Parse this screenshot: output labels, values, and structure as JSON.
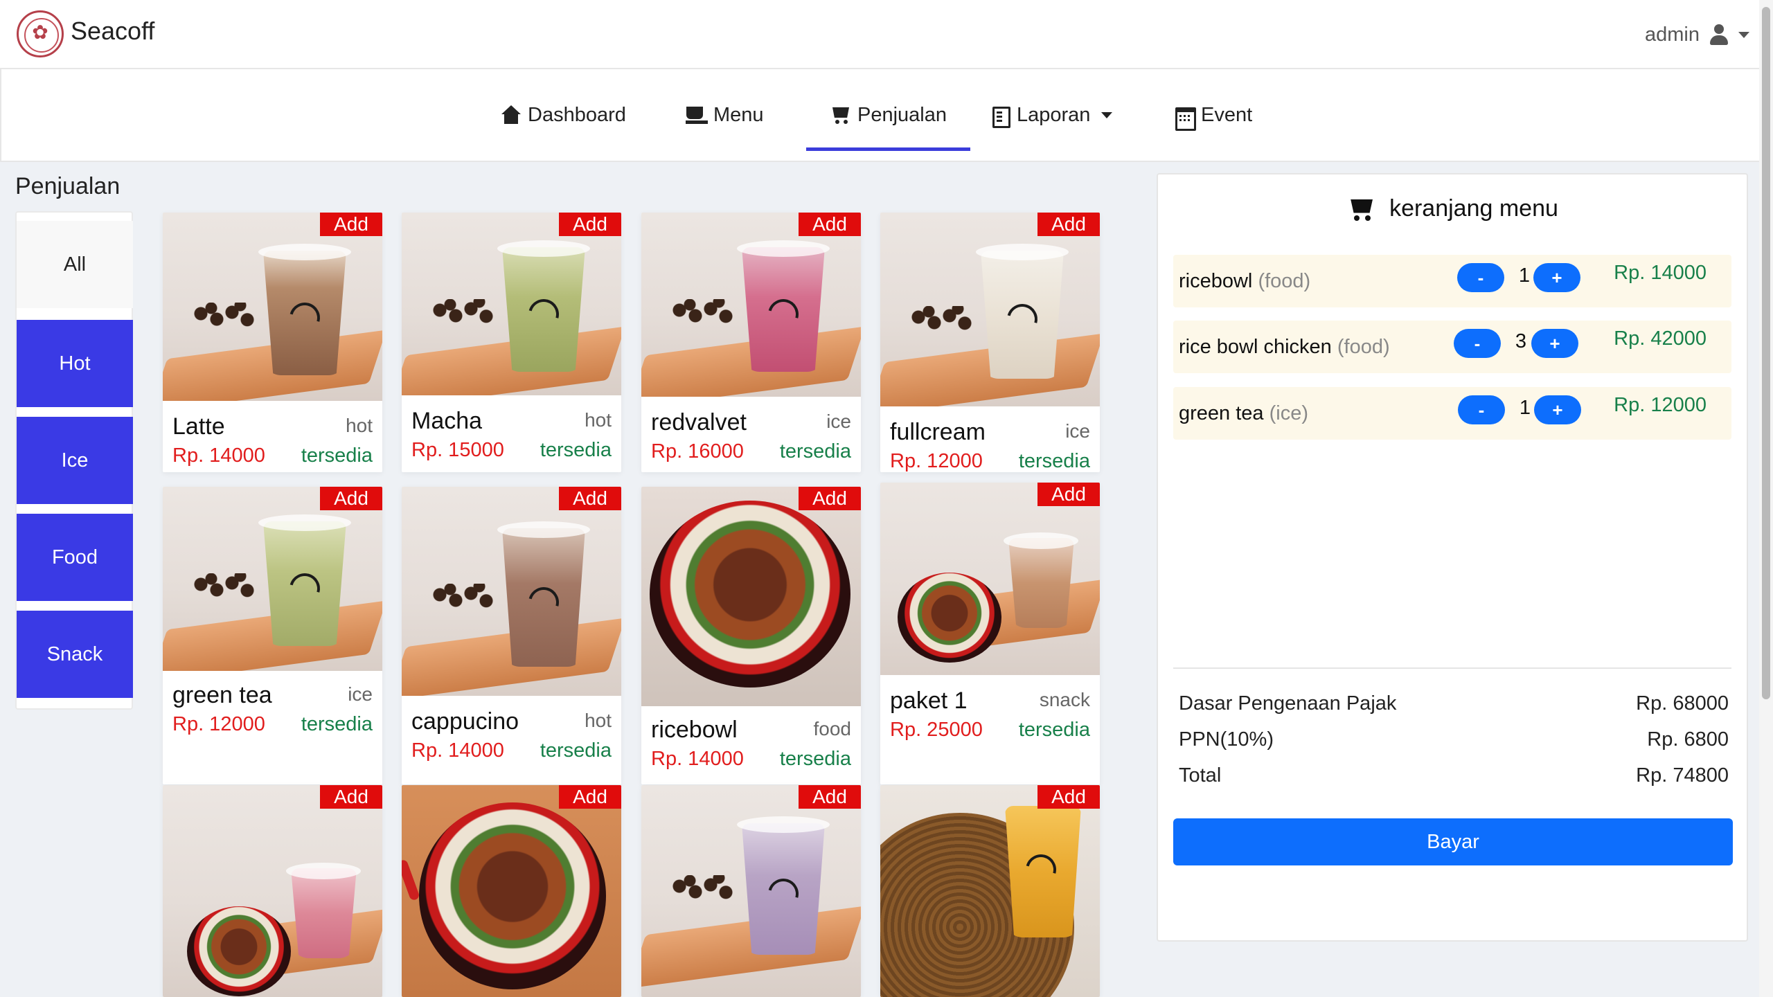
{
  "app": {
    "brand": "Seacoff",
    "user": "admin"
  },
  "nav": {
    "dashboard": "Dashboard",
    "menu": "Menu",
    "penjualan": "Penjualan",
    "laporan": "Laporan",
    "event": "Event",
    "active": "Penjualan"
  },
  "page": {
    "title": "Penjualan"
  },
  "categories": [
    "All",
    "Hot",
    "Ice",
    "Food",
    "Snack"
  ],
  "add_label": "Add",
  "products": [
    {
      "name": "Latte",
      "type": "hot",
      "price": "Rp. 14000",
      "stock": "tersedia"
    },
    {
      "name": "Macha",
      "type": "hot",
      "price": "Rp. 15000",
      "stock": "tersedia"
    },
    {
      "name": "redvalvet",
      "type": "ice",
      "price": "Rp. 16000",
      "stock": "tersedia"
    },
    {
      "name": "fullcream",
      "type": "ice",
      "price": "Rp. 12000",
      "stock": "tersedia"
    },
    {
      "name": "green tea",
      "type": "ice",
      "price": "Rp. 12000",
      "stock": "tersedia"
    },
    {
      "name": "cappucino",
      "type": "hot",
      "price": "Rp. 14000",
      "stock": "tersedia"
    },
    {
      "name": "ricebowl",
      "type": "food",
      "price": "Rp. 14000",
      "stock": "tersedia"
    },
    {
      "name": "paket 1",
      "type": "snack",
      "price": "Rp. 25000",
      "stock": "tersedia"
    }
  ],
  "cart": {
    "title": "keranjang menu",
    "minus_label": "-",
    "plus_label": "+",
    "items": [
      {
        "name": "ricebowl",
        "category": "(food)",
        "qty": "1",
        "price": "Rp. 14000"
      },
      {
        "name": "rice bowl chicken",
        "category": "(food)",
        "qty": "3",
        "price": "Rp. 42000"
      },
      {
        "name": "green tea",
        "category": "(ice)",
        "qty": "1",
        "price": "Rp. 12000"
      }
    ],
    "summary": [
      {
        "label": "Dasar Pengenaan Pajak",
        "value": "Rp. 68000"
      },
      {
        "label": "PPN(10%)",
        "value": "Rp. 6800"
      },
      {
        "label": "Total",
        "value": "Rp. 74800"
      }
    ],
    "pay_label": "Bayar"
  },
  "colors": {
    "accent": "#3a3ae5",
    "primary": "#0d6efd",
    "add": "#e00c0c",
    "price": "#e11d1d",
    "stock": "#18804a"
  }
}
